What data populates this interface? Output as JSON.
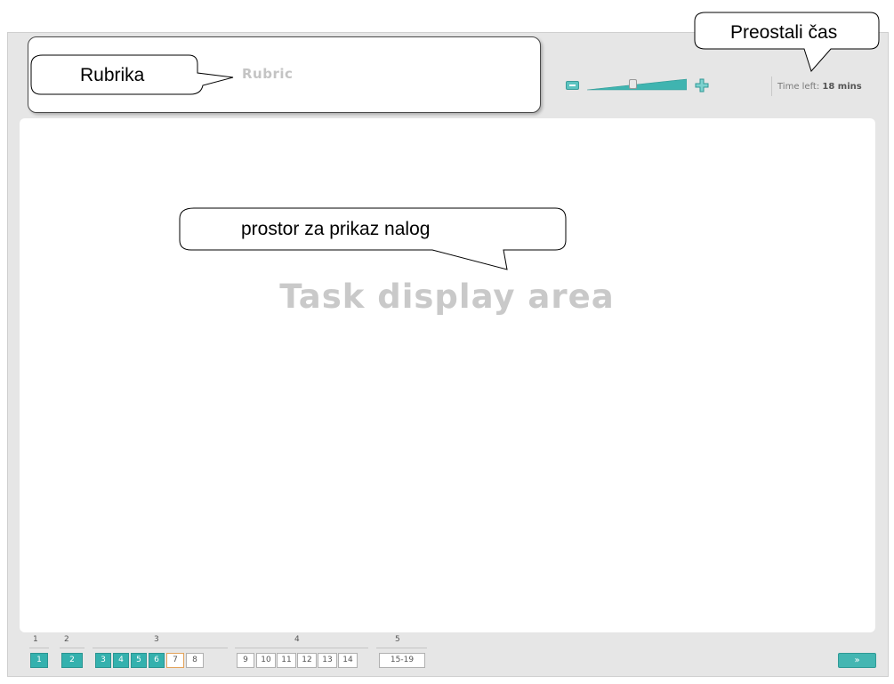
{
  "header": {
    "rubric_label": "Rubric",
    "time_left_label": "Time left:",
    "time_left_value": "18 mins",
    "zoom": {
      "minus_icon": "minus-icon",
      "plus_icon": "plus-icon",
      "level_fraction": 0.46
    }
  },
  "main": {
    "task_area_label": "Task display area"
  },
  "callouts": {
    "rubric": "Rubrika",
    "time_left": "Preostali čas",
    "task_area": "prostor za prikaz nalog"
  },
  "navigation": {
    "sections": [
      {
        "label": "1",
        "questions": [
          {
            "label": "1",
            "state": "done"
          }
        ]
      },
      {
        "label": "2",
        "questions": [
          {
            "label": "2",
            "state": "done"
          }
        ]
      },
      {
        "label": "3",
        "questions": [
          {
            "label": "3",
            "state": "done"
          },
          {
            "label": "4",
            "state": "done"
          },
          {
            "label": "5",
            "state": "done"
          },
          {
            "label": "6",
            "state": "done"
          },
          {
            "label": "7",
            "state": "current"
          },
          {
            "label": "8",
            "state": "pending"
          }
        ]
      },
      {
        "label": "4",
        "questions": [
          {
            "label": "9",
            "state": "pending"
          },
          {
            "label": "10",
            "state": "pending"
          },
          {
            "label": "11",
            "state": "pending"
          },
          {
            "label": "12",
            "state": "pending"
          },
          {
            "label": "13",
            "state": "pending"
          },
          {
            "label": "14",
            "state": "pending"
          }
        ]
      },
      {
        "label": "5",
        "questions": [
          {
            "label": "15-19",
            "state": "pending"
          }
        ]
      }
    ],
    "next_label": "»"
  },
  "colors": {
    "accent": "#34b1ae",
    "current_border": "#e3a35a",
    "watermark_text": "#c9c9c9"
  }
}
